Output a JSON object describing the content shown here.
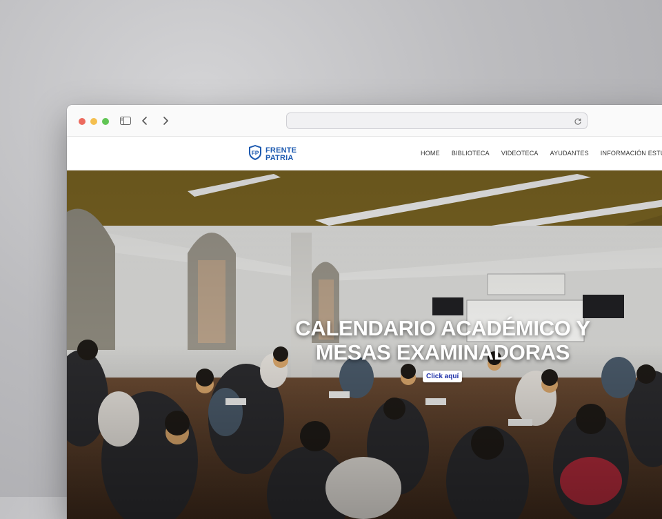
{
  "browser": {
    "url_value": "",
    "icons": [
      "sidebar-icon",
      "back-icon",
      "forward-icon",
      "reload-icon"
    ]
  },
  "site": {
    "logo": {
      "line1": "FRENTE",
      "line2": "PATRIA",
      "emblem": "FP"
    },
    "menu": [
      "HOME",
      "BIBLIOTECA",
      "VIDEOTECA",
      "AYUDANTES",
      "INFORMACIÓN ESTUDIANTIL"
    ]
  },
  "hero": {
    "title_line1": "CALENDARIO ACADÉMICO Y",
    "title_line2": "MESAS EXAMINADORAS",
    "cta_label": "Click aquí"
  },
  "colors": {
    "brand_blue": "#1d5ab0",
    "cta_text": "#1d2fa8"
  }
}
